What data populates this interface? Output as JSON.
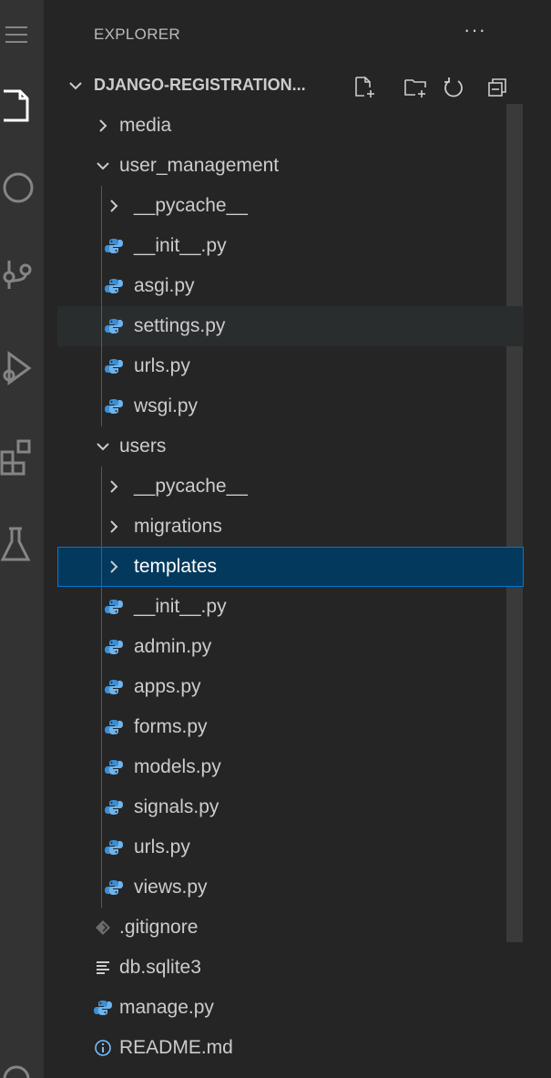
{
  "activity_bar": {
    "icons": [
      "menu-icon",
      "files-icon",
      "search-icon",
      "source-control-icon",
      "run-debug-icon",
      "extensions-icon",
      "testing-icon",
      "accounts-icon"
    ]
  },
  "explorer": {
    "title": "EXPLORER",
    "more_actions": "···",
    "project": {
      "name": "DJANGO-REGISTRATION...",
      "actions": [
        "new-file-icon",
        "new-folder-icon",
        "refresh-icon",
        "collapse-all-icon"
      ]
    },
    "tree": [
      {
        "label": "media",
        "type": "folder",
        "expanded": false,
        "depth": 1
      },
      {
        "label": "user_management",
        "type": "folder",
        "expanded": true,
        "depth": 1
      },
      {
        "label": "__pycache__",
        "type": "folder",
        "expanded": false,
        "depth": 2
      },
      {
        "label": "__init__.py",
        "type": "python",
        "depth": 2
      },
      {
        "label": "asgi.py",
        "type": "python",
        "depth": 2
      },
      {
        "label": "settings.py",
        "type": "python",
        "depth": 2,
        "hovered": true
      },
      {
        "label": "urls.py",
        "type": "python",
        "depth": 2
      },
      {
        "label": "wsgi.py",
        "type": "python",
        "depth": 2
      },
      {
        "label": "users",
        "type": "folder",
        "expanded": true,
        "depth": 1
      },
      {
        "label": "__pycache__",
        "type": "folder",
        "expanded": false,
        "depth": 2
      },
      {
        "label": "migrations",
        "type": "folder",
        "expanded": false,
        "depth": 2
      },
      {
        "label": "templates",
        "type": "folder",
        "expanded": false,
        "depth": 2,
        "selected": true
      },
      {
        "label": "__init__.py",
        "type": "python",
        "depth": 2
      },
      {
        "label": "admin.py",
        "type": "python",
        "depth": 2
      },
      {
        "label": "apps.py",
        "type": "python",
        "depth": 2
      },
      {
        "label": "forms.py",
        "type": "python",
        "depth": 2
      },
      {
        "label": "models.py",
        "type": "python",
        "depth": 2
      },
      {
        "label": "signals.py",
        "type": "python",
        "depth": 2
      },
      {
        "label": "urls.py",
        "type": "python",
        "depth": 2
      },
      {
        "label": "views.py",
        "type": "python",
        "depth": 2
      },
      {
        "label": ".gitignore",
        "type": "gitignore",
        "depth": 1
      },
      {
        "label": "db.sqlite3",
        "type": "database",
        "depth": 1
      },
      {
        "label": "manage.py",
        "type": "python",
        "depth": 1
      },
      {
        "label": "README.md",
        "type": "info",
        "depth": 1
      }
    ]
  },
  "colors": {
    "python_icon": "#3c8fd6",
    "selected_bg": "#04395e",
    "selected_border": "#0078d4",
    "hover_bg": "#2a2d2e",
    "sidebar_bg": "#252526",
    "activity_bar_bg": "#333333"
  }
}
